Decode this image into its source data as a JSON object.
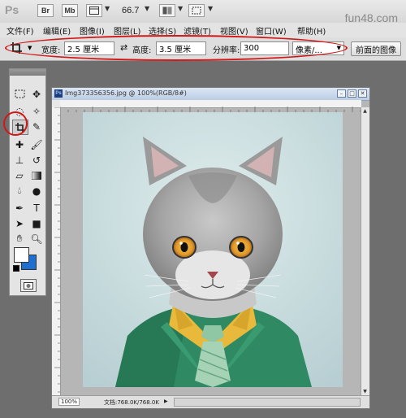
{
  "app": {
    "logo": "Ps",
    "bridge_label": "Br",
    "minibridge_label": "Mb",
    "zoom": "66.7",
    "watermark": "fun48.com"
  },
  "menus": [
    "文件(F)",
    "编辑(E)",
    "图像(I)",
    "图层(L)",
    "选择(S)",
    "滤镜(T)",
    "视图(V)",
    "窗口(W)",
    "帮助(H)"
  ],
  "options": {
    "width_label": "宽度:",
    "width_value": "2.5 厘米",
    "swap_icon": "⇄",
    "height_label": "高度:",
    "height_value": "3.5 厘米",
    "resolution_label": "分辨率:",
    "resolution_value": "300",
    "unit_value": "像素/...",
    "front_image_button": "前面的图像"
  },
  "document": {
    "title": "Img373356356.jpg @ 100%(RGB/8#)",
    "zoom": "100%",
    "doc_size": "文档:768.0K/768.0K"
  },
  "colors": {
    "highlight": "#d01818",
    "background_swatch": "#1f6fd0"
  }
}
